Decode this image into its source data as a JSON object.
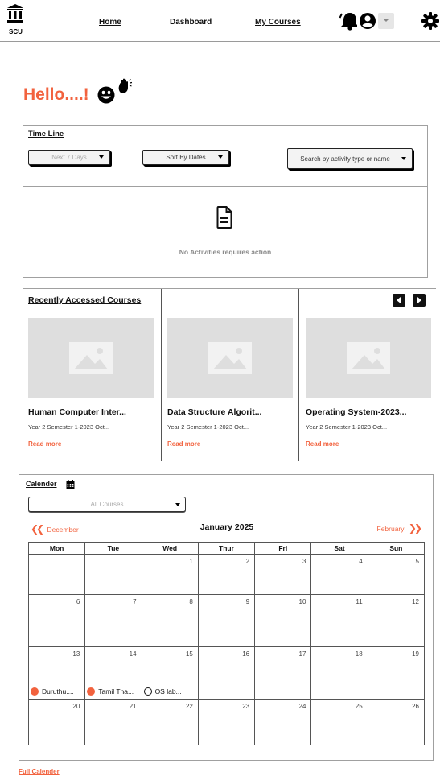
{
  "header": {
    "logo_text": "SCU",
    "nav": [
      {
        "label": "Home"
      },
      {
        "label": "Dashboard"
      },
      {
        "label": "My Courses"
      }
    ]
  },
  "greeting": {
    "text": "Hello....!"
  },
  "timeline": {
    "title": "Time Line",
    "range_select": "Next 7 Days",
    "sort_select": "Sort By Dates",
    "search_select": "Search by activity type or name",
    "empty_message": "No Activities requires action"
  },
  "recent_courses": {
    "title": "Recently Accessed Courses",
    "courses": [
      {
        "name": "Human Computer Inter...",
        "meta": "Year 2 Semester 1-2023 Oct...",
        "link": "Read more"
      },
      {
        "name": "Data Structure Algorit...",
        "meta": "Year 2 Semester 1-2023 Oct...",
        "link": "Read more"
      },
      {
        "name": "Operating System-2023...",
        "meta": "Year 2 Semester 1-2023 Oct...",
        "link": "Read more"
      }
    ]
  },
  "calendar": {
    "title": "Calender",
    "course_filter": "All Courses",
    "prev_month": "December",
    "current_month": "January 2025",
    "next_month": "February",
    "weekdays": [
      "Mon",
      "Tue",
      "Wed",
      "Thur",
      "Fri",
      "Sat",
      "Sun"
    ],
    "weeks": [
      [
        "",
        "",
        "1",
        "2",
        "3",
        "4",
        "5"
      ],
      [
        "6",
        "7",
        "8",
        "9",
        "10",
        "11",
        "12"
      ],
      [
        "13",
        "14",
        "15",
        "16",
        "17",
        "18",
        "19"
      ],
      [
        "20",
        "21",
        "22",
        "23",
        "24",
        "25",
        "26"
      ]
    ],
    "events": [
      {
        "label": "Duruthu....",
        "style": "filled"
      },
      {
        "label": "Tamil Tha...",
        "style": "filled"
      },
      {
        "label": "OS lab...",
        "style": "outline"
      }
    ],
    "full_calendar_link": "Full Calender"
  },
  "colors": {
    "accent": "#f2623e",
    "placeholder_gray": "#dedede"
  }
}
